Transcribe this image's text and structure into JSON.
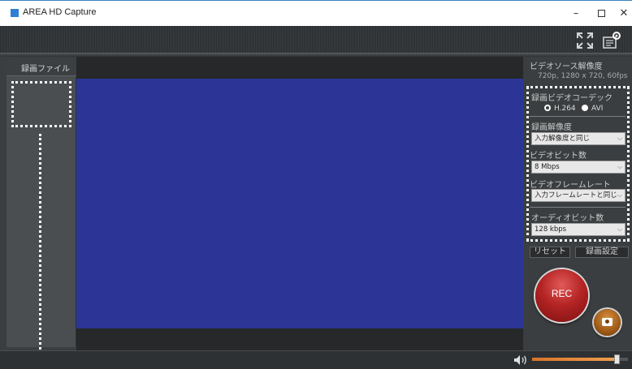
{
  "window": {
    "title": "AREA HD Capture",
    "minimize_glyph": "–",
    "close_glyph": "✕"
  },
  "toolbar": {
    "icons": [
      "fullscreen-icon",
      "settings-icon"
    ]
  },
  "left_panel": {
    "header": "録画ファイル"
  },
  "video_source": {
    "label": "ビデオソース解像度",
    "value": "720p, 1280 x 720, 60fps"
  },
  "codec": {
    "label": "録画ビデオコーデック",
    "options": [
      "H.264",
      "AVI"
    ],
    "selected": "AVI"
  },
  "resolution": {
    "label": "録画解像度",
    "value": "入力解像度と同じ"
  },
  "video_bitrate": {
    "label": "ビデオビット数",
    "value": "8 Mbps"
  },
  "framerate": {
    "label": "ビデオフレームレート",
    "value": "入力フレームレートと同じ"
  },
  "audio_bitrate": {
    "label": "オーディオビット数",
    "value": "128 kbps"
  },
  "buttons": {
    "reset": "リセット",
    "rec_settings": "録画設定",
    "rec": "REC"
  },
  "volume": {
    "level": 0.88
  },
  "colors": {
    "preview": "#2c3596",
    "rec": "#b52424",
    "snapshot": "#9e5a18",
    "accent_volume": "#e08a3a"
  }
}
